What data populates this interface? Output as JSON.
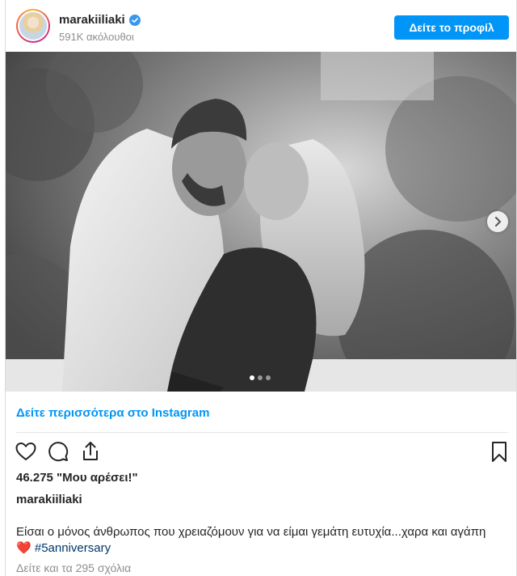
{
  "header": {
    "username": "marakiiliaki",
    "followers": "591K ακόλουθοι",
    "profile_button": "Δείτε το προφίλ"
  },
  "post": {
    "carousel_count": 3,
    "carousel_active": 1
  },
  "more_link": "Δείτε περισσότερα στο Instagram",
  "icons": [
    "heart-icon",
    "comment-icon",
    "share-icon",
    "bookmark-icon",
    "verified-icon",
    "chevron-right-icon"
  ],
  "likes": "46.275 \"Μου αρέσει!\"",
  "caption": {
    "username": "marakiiliaki",
    "text": "Είσαι ο μόνος άνθρωπος που χρειαζόμουν για να είμαι γεμάτη ευτυχία...χαρα και αγάπη",
    "emoji": "❤️",
    "hashtag": "#5anniversary"
  },
  "comments_link": "Δείτε και τα 295 σχόλια",
  "colors": {
    "accent": "#0095f6",
    "text": "#262626",
    "muted": "#8e8e8e",
    "hashtag": "#00376b"
  }
}
